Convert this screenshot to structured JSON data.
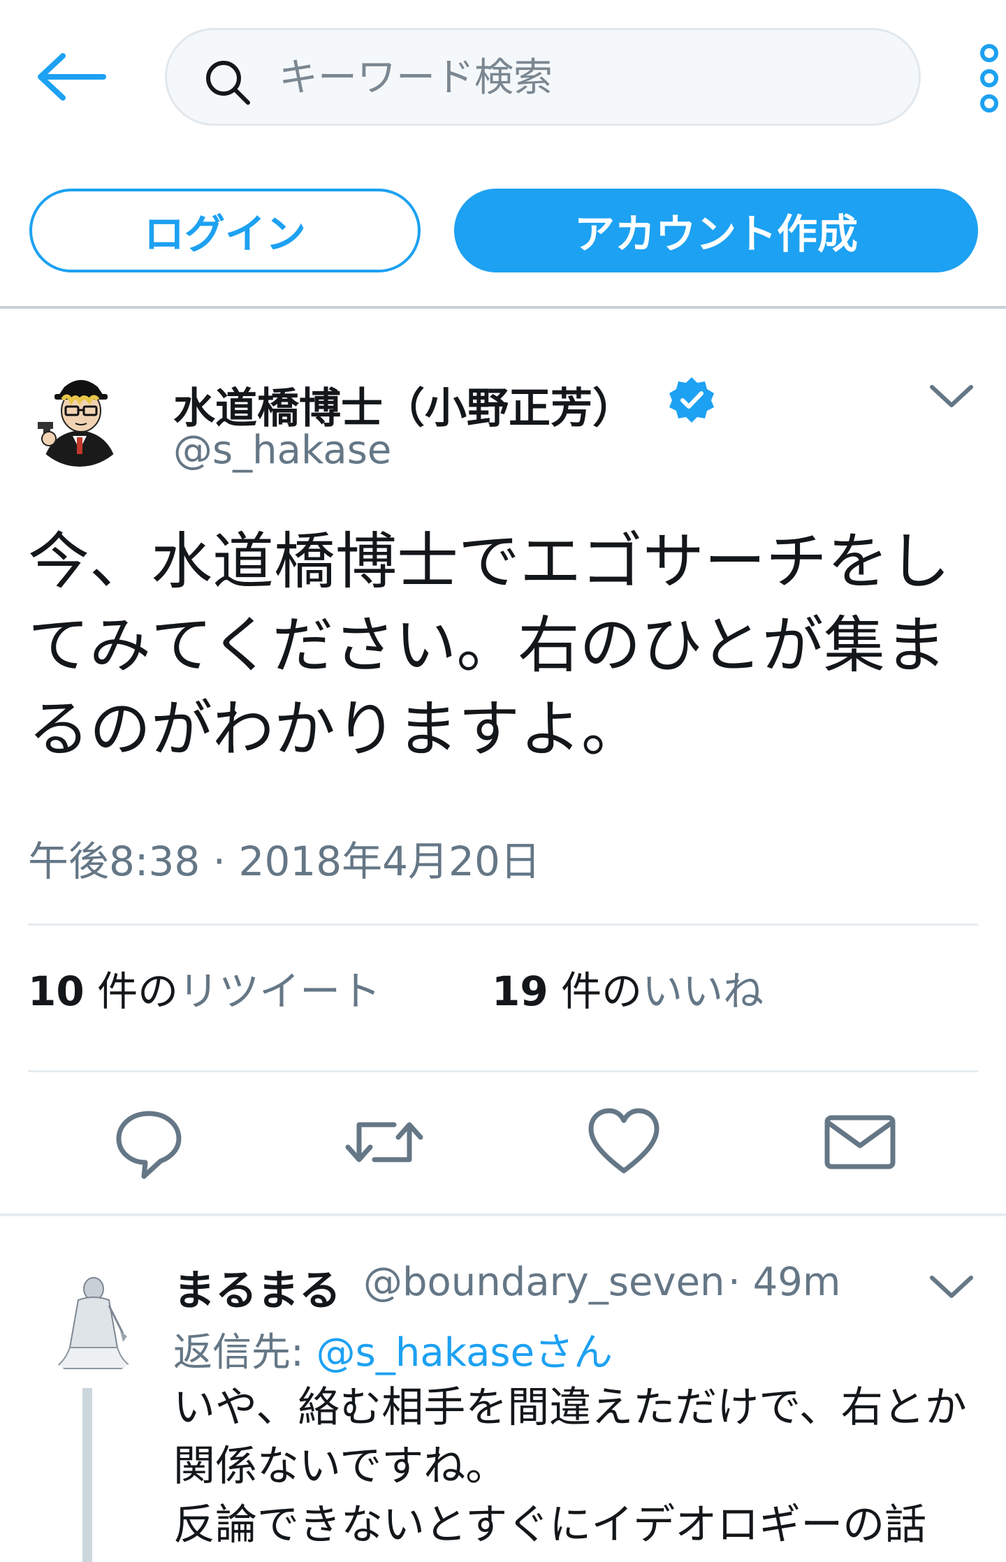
{
  "header": {
    "search_placeholder": "キーワード検索",
    "login_label": "ログイン",
    "signup_label": "アカウント作成"
  },
  "tweet": {
    "display_name": "水道橋博士（小野正芳）",
    "username": "@s_hakase",
    "text": "今、水道橋博士でエゴサーチをしてみてください。右のひとが集まるのがわかりますよ。",
    "timestamp": "午後8:38 · 2018年4月20日",
    "retweet_count": "10",
    "retweet_unit": " 件の",
    "retweet_label": "リツイート",
    "like_count": "19",
    "like_unit": " 件の",
    "like_label": "いいね"
  },
  "reply": {
    "display_name": "まるまる",
    "username": "@boundary_seven",
    "separator": " · ",
    "time": "49m",
    "reply_to_prefix": "返信先: ",
    "reply_to_mention": "@s_hakase",
    "reply_to_suffix": "さん",
    "text": "いや、絡む相手を間違えただけで、右とか関係ないですね。\n反論できないとすぐにイデオロギーの話"
  },
  "icons": {
    "back": "back-arrow-icon",
    "search": "search-icon",
    "more": "more-vertical-icon",
    "verified": "verified-badge-icon",
    "chevron": "chevron-down-icon",
    "reply": "reply-icon",
    "retweet": "retweet-icon",
    "like": "heart-icon",
    "dm": "envelope-icon"
  },
  "colors": {
    "accent": "#1da1f2",
    "text": "#14171a",
    "secondary": "#657786",
    "border": "#e6ecf0"
  }
}
